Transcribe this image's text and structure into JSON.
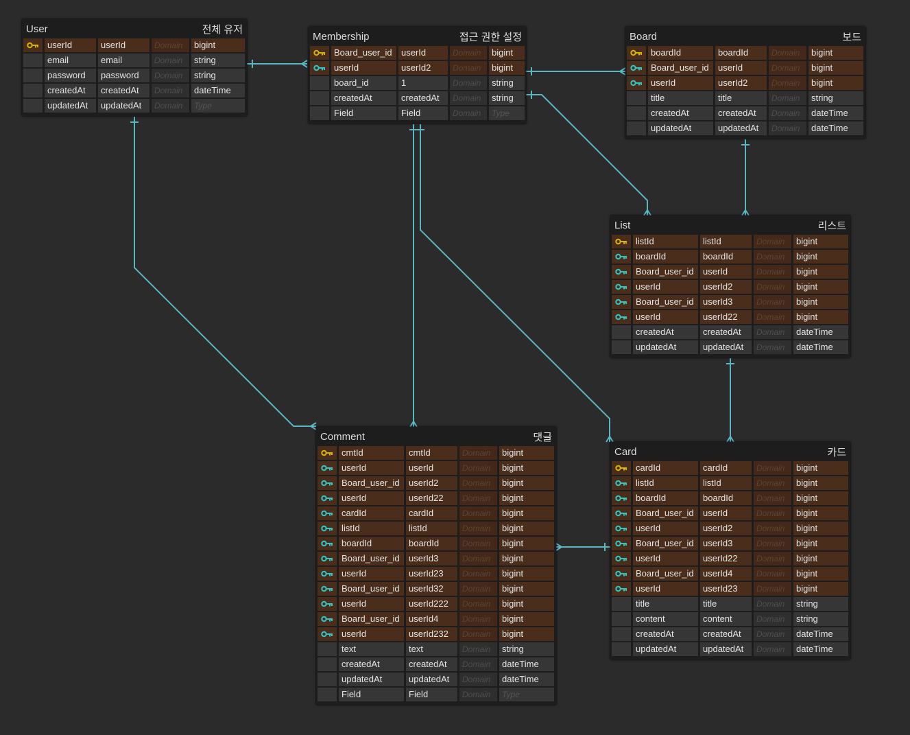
{
  "colors": {
    "background": "#2b2b2b",
    "relation_line": "#5ab7c2",
    "primary_key": "#d9b400",
    "foreign_key": "#2fc6c6",
    "key_row": "#4a2e1b"
  },
  "tables": [
    {
      "id": "user",
      "name": "User",
      "label": "전체 유저",
      "rows": [
        [
          "pk",
          "userId",
          "userId",
          "Domain",
          "bigint"
        ],
        [
          "",
          "email",
          "email",
          "Domain",
          "string"
        ],
        [
          "",
          "password",
          "password",
          "Domain",
          "string"
        ],
        [
          "",
          "createdAt",
          "createdAt",
          "Domain",
          "dateTime"
        ],
        [
          "",
          "updatedAt",
          "updatedAt",
          "Domain",
          "Type"
        ]
      ]
    },
    {
      "id": "membership",
      "name": "Membership",
      "label": "접근 권한 설정",
      "rows": [
        [
          "pk",
          "Board_user_id",
          "userId",
          "Domain",
          "bigint"
        ],
        [
          "fk",
          "userId",
          "userId2",
          "Domain",
          "bigint"
        ],
        [
          "",
          "board_id",
          "1",
          "Domain",
          "string"
        ],
        [
          "",
          "createdAt",
          "createdAt",
          "Domain",
          "string"
        ],
        [
          "",
          "Field",
          "Field",
          "Domain",
          "Type"
        ]
      ]
    },
    {
      "id": "board",
      "name": "Board",
      "label": "보드",
      "rows": [
        [
          "pk",
          "boardId",
          "boardId",
          "Domain",
          "bigint"
        ],
        [
          "fk",
          "Board_user_id",
          "userId",
          "Domain",
          "bigint"
        ],
        [
          "fk",
          "userId",
          "userId2",
          "Domain",
          "bigint"
        ],
        [
          "",
          "title",
          "title",
          "Domain",
          "string"
        ],
        [
          "",
          "createdAt",
          "createdAt",
          "Domain",
          "dateTime"
        ],
        [
          "",
          "updatedAt",
          "updatedAt",
          "Domain",
          "dateTime"
        ]
      ]
    },
    {
      "id": "list",
      "name": "List",
      "label": "리스트",
      "rows": [
        [
          "pk",
          "listId",
          "listId",
          "Domain",
          "bigint"
        ],
        [
          "fk",
          "boardId",
          "boardId",
          "Domain",
          "bigint"
        ],
        [
          "fk",
          "Board_user_id",
          "userId",
          "Domain",
          "bigint"
        ],
        [
          "fk",
          "userId",
          "userId2",
          "Domain",
          "bigint"
        ],
        [
          "fk",
          "Board_user_id",
          "userId3",
          "Domain",
          "bigint"
        ],
        [
          "fk",
          "userId",
          "userId22",
          "Domain",
          "bigint"
        ],
        [
          "",
          "createdAt",
          "createdAt",
          "Domain",
          "dateTime"
        ],
        [
          "",
          "updatedAt",
          "updatedAt",
          "Domain",
          "dateTime"
        ]
      ]
    },
    {
      "id": "comment",
      "name": "Comment",
      "label": "댓글",
      "rows": [
        [
          "pk",
          "cmtId",
          "cmtId",
          "Domain",
          "bigint"
        ],
        [
          "fk",
          "userId",
          "userId",
          "Domain",
          "bigint"
        ],
        [
          "fk",
          "Board_user_id",
          "userId2",
          "Domain",
          "bigint"
        ],
        [
          "fk",
          "userId",
          "userId22",
          "Domain",
          "bigint"
        ],
        [
          "fk",
          "cardId",
          "cardId",
          "Domain",
          "bigint"
        ],
        [
          "fk",
          "listId",
          "listId",
          "Domain",
          "bigint"
        ],
        [
          "fk",
          "boardId",
          "boardId",
          "Domain",
          "bigint"
        ],
        [
          "fk",
          "Board_user_id",
          "userId3",
          "Domain",
          "bigint"
        ],
        [
          "fk",
          "userId",
          "userId23",
          "Domain",
          "bigint"
        ],
        [
          "fk",
          "Board_user_id",
          "userId32",
          "Domain",
          "bigint"
        ],
        [
          "fk",
          "userId",
          "userId222",
          "Domain",
          "bigint"
        ],
        [
          "fk",
          "Board_user_id",
          "userId4",
          "Domain",
          "bigint"
        ],
        [
          "fk",
          "userId",
          "userId232",
          "Domain",
          "bigint"
        ],
        [
          "",
          "text",
          "text",
          "Domain",
          "string"
        ],
        [
          "",
          "createdAt",
          "createdAt",
          "Domain",
          "dateTime"
        ],
        [
          "",
          "updatedAt",
          "updatedAt",
          "Domain",
          "dateTime"
        ],
        [
          "",
          "Field",
          "Field",
          "Domain",
          "Type"
        ]
      ]
    },
    {
      "id": "card",
      "name": "Card",
      "label": "카드",
      "rows": [
        [
          "pk",
          "cardId",
          "cardId",
          "Domain",
          "bigint"
        ],
        [
          "fk",
          "listId",
          "listId",
          "Domain",
          "bigint"
        ],
        [
          "fk",
          "boardId",
          "boardId",
          "Domain",
          "bigint"
        ],
        [
          "fk",
          "Board_user_id",
          "userId",
          "Domain",
          "bigint"
        ],
        [
          "fk",
          "userId",
          "userId2",
          "Domain",
          "bigint"
        ],
        [
          "fk",
          "Board_user_id",
          "userId3",
          "Domain",
          "bigint"
        ],
        [
          "fk",
          "userId",
          "userId22",
          "Domain",
          "bigint"
        ],
        [
          "fk",
          "Board_user_id",
          "userId4",
          "Domain",
          "bigint"
        ],
        [
          "fk",
          "userId",
          "userId23",
          "Domain",
          "bigint"
        ],
        [
          "",
          "title",
          "title",
          "Domain",
          "string"
        ],
        [
          "",
          "content",
          "content",
          "Domain",
          "string"
        ],
        [
          "",
          "createdAt",
          "createdAt",
          "Domain",
          "dateTime"
        ],
        [
          "",
          "updatedAt",
          "updatedAt",
          "Domain",
          "dateTime"
        ]
      ]
    }
  ]
}
